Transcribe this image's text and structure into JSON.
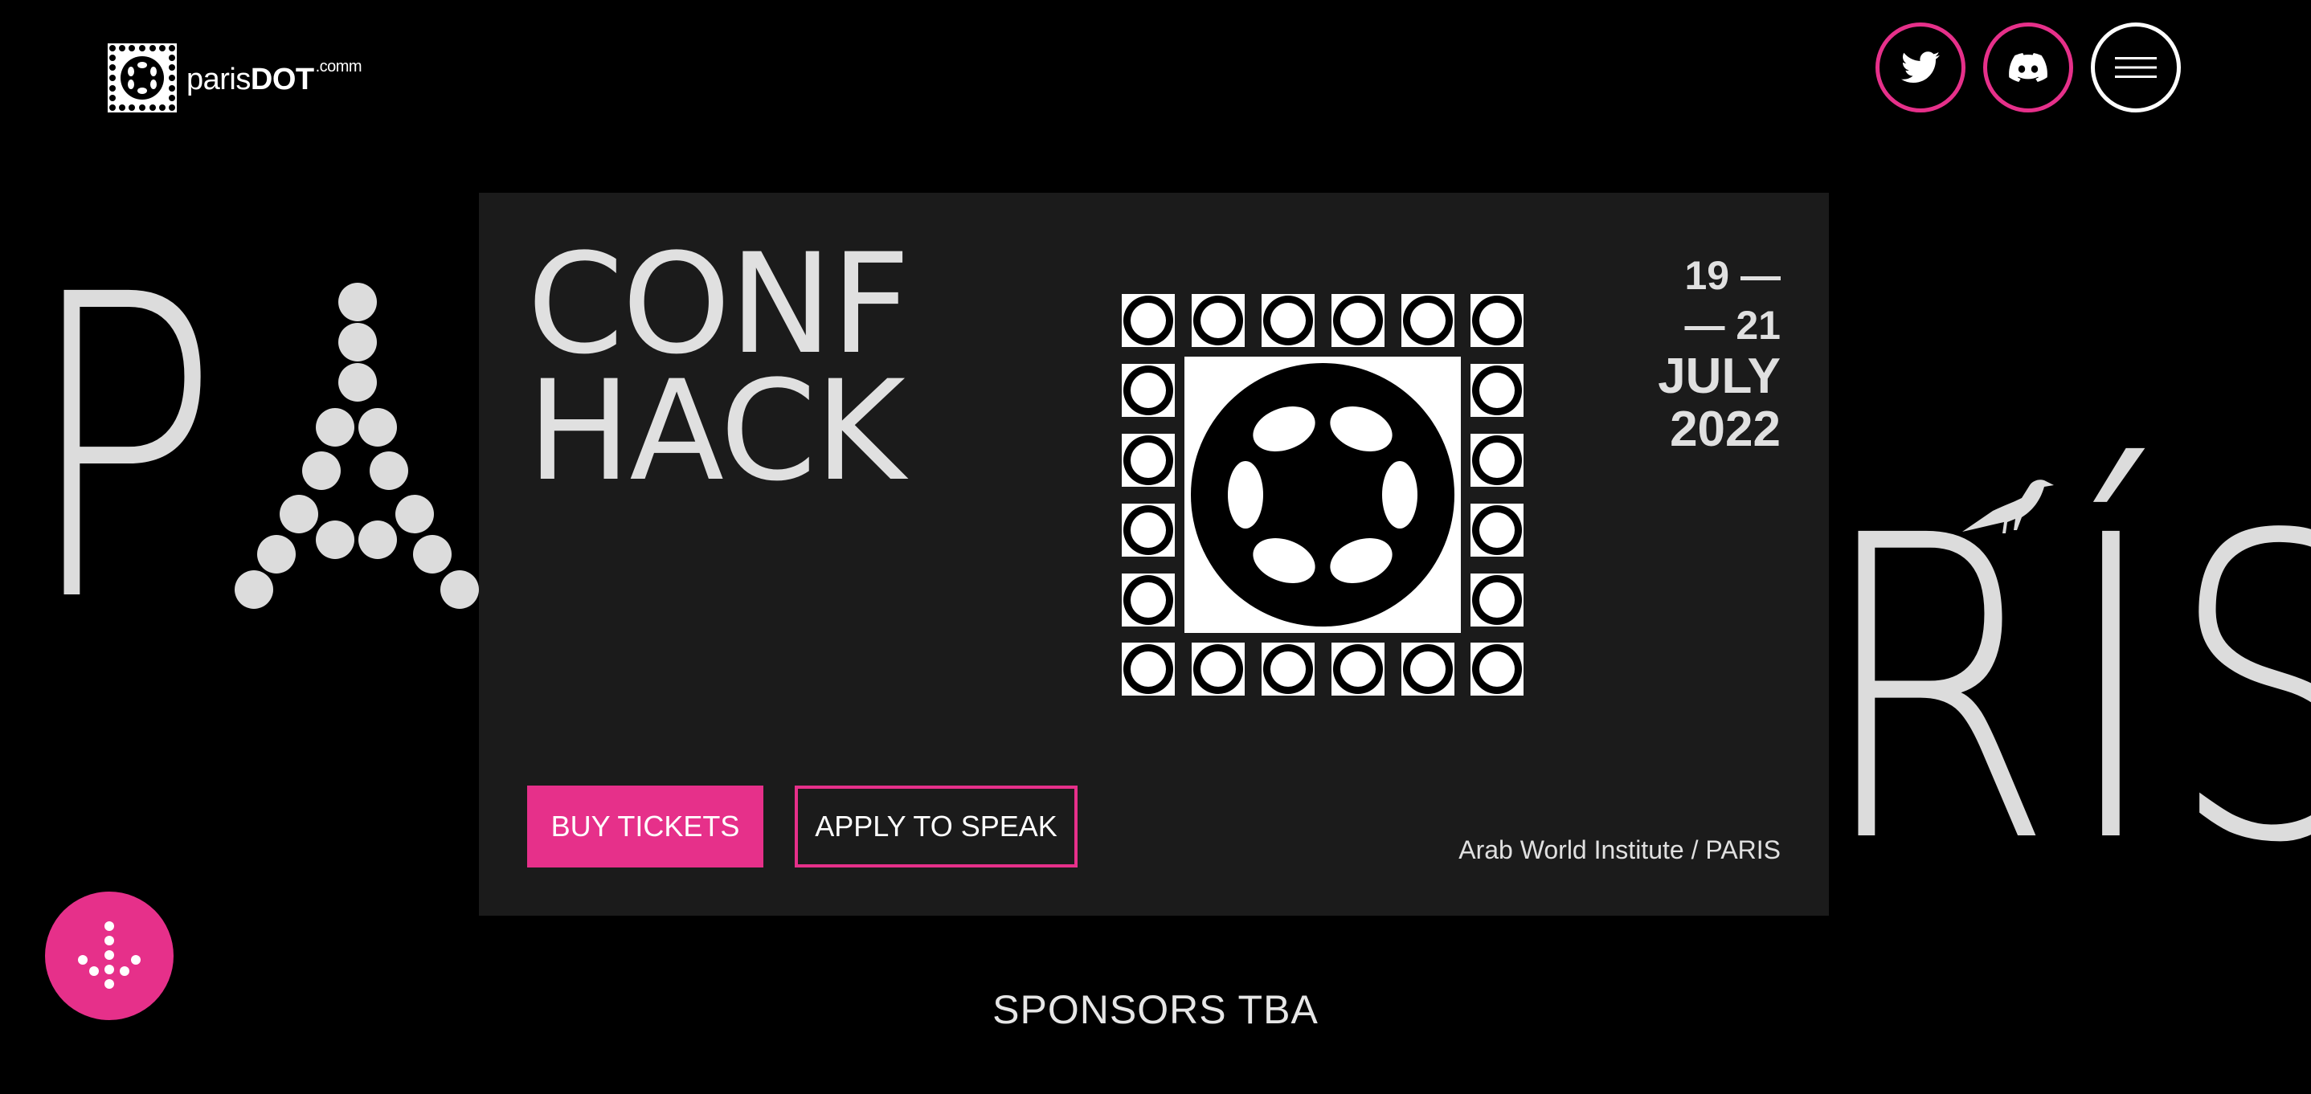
{
  "header": {
    "logo_name": "paris",
    "logo_bold": "DOT",
    "logo_sup": ".comm",
    "icons": [
      "twitter-icon",
      "discord-icon",
      "menu-icon"
    ]
  },
  "background": {
    "left_letter": "P",
    "right_letters": "RÍS"
  },
  "card": {
    "title_line1": "CONF",
    "title_line2": "HACK",
    "date_line1": "19 —",
    "date_line2": "— 21",
    "date_month": "JULY",
    "date_year": "2022",
    "buy_label": "BUY TICKETS",
    "speak_label": "APPLY TO SPEAK",
    "venue": "Arab World Institute / PARIS"
  },
  "footer": {
    "sponsors": "SPONSORS TBA"
  },
  "colors": {
    "accent": "#e6308a",
    "background": "#000000",
    "card": "#1b1b1b",
    "text": "#e0e0e0"
  }
}
